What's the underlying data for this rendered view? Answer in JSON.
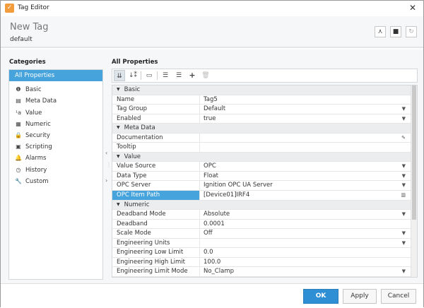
{
  "window": {
    "title": "Tag Editor"
  },
  "header": {
    "tag_name": "New Tag",
    "provider": "default",
    "icons": [
      "tag-type-icon",
      "notes-icon",
      "refresh-icon"
    ]
  },
  "categories": {
    "title": "Categories",
    "items": [
      {
        "label": "All Properties",
        "icon": "none",
        "selected": true
      },
      {
        "label": "Basic",
        "icon": "info-icon",
        "glyph": "❶"
      },
      {
        "label": "Meta Data",
        "icon": "metadata-icon",
        "glyph": "▤"
      },
      {
        "label": "Value",
        "icon": "value-icon",
        "glyph": "¹a"
      },
      {
        "label": "Numeric",
        "icon": "calculator-icon",
        "glyph": "▦"
      },
      {
        "label": "Security",
        "icon": "lock-icon",
        "glyph": "🔒"
      },
      {
        "label": "Scripting",
        "icon": "script-icon",
        "glyph": "▣"
      },
      {
        "label": "Alarms",
        "icon": "bell-icon",
        "glyph": "🔔"
      },
      {
        "label": "History",
        "icon": "clock-icon",
        "glyph": "◷"
      },
      {
        "label": "Custom",
        "icon": "wrench-icon",
        "glyph": "🔧"
      }
    ]
  },
  "properties": {
    "title": "All Properties",
    "rows": [
      {
        "group": "Basic"
      },
      {
        "key": "Name",
        "value": "Tag5"
      },
      {
        "key": "Tag Group",
        "value": "Default",
        "dropdown": true
      },
      {
        "key": "Enabled",
        "value": "true",
        "dropdown": true
      },
      {
        "group": "Meta Data"
      },
      {
        "key": "Documentation",
        "value": "",
        "edit": true
      },
      {
        "key": "Tooltip",
        "value": ""
      },
      {
        "group": "Value"
      },
      {
        "key": "Value Source",
        "value": "OPC",
        "dropdown": true
      },
      {
        "key": "Data Type",
        "value": "Float",
        "dropdown": true
      },
      {
        "key": "OPC Server",
        "value": "Ignition OPC UA Server",
        "dropdown": true
      },
      {
        "key": "OPC Item Path",
        "value": "[Device01]IRF4",
        "selected": true,
        "browse": true
      },
      {
        "group": "Numeric"
      },
      {
        "key": "Deadband Mode",
        "value": "Absolute",
        "dropdown": true
      },
      {
        "key": "Deadband",
        "value": "0.0001"
      },
      {
        "key": "Scale Mode",
        "value": "Off",
        "dropdown": true
      },
      {
        "key": "Engineering Units",
        "value": "",
        "dropdown": true
      },
      {
        "key": "Engineering Low Limit",
        "value": "0.0"
      },
      {
        "key": "Engineering High Limit",
        "value": "100.0"
      },
      {
        "key": "Engineering Limit Mode",
        "value": "No_Clamp",
        "dropdown": true
      }
    ]
  },
  "footer": {
    "ok": "OK",
    "apply": "Apply",
    "cancel": "Cancel"
  }
}
